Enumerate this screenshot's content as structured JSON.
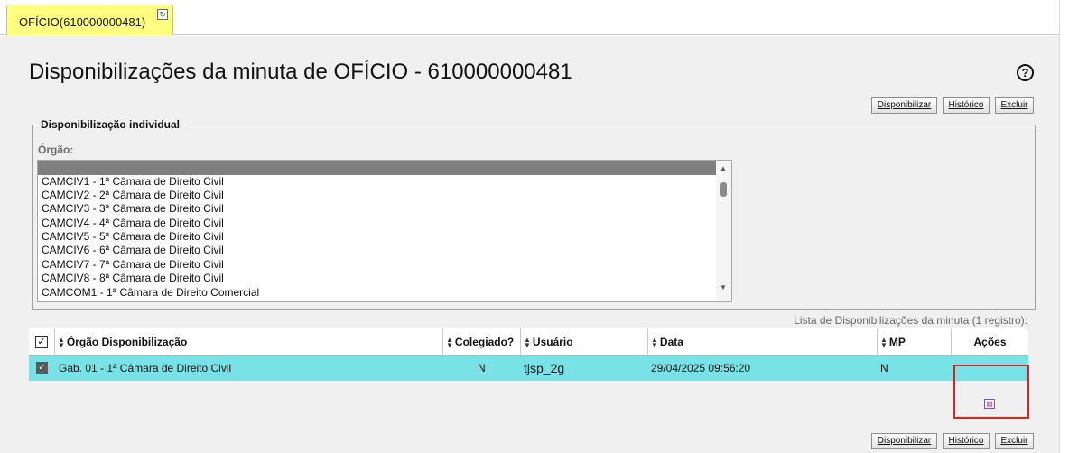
{
  "tab": {
    "label": "OFÍCIO(610000000481)",
    "refresh_icon": "refresh-icon"
  },
  "page": {
    "title": "Disponibilizações da minuta de OFÍCIO - 610000000481",
    "help_icon": "?"
  },
  "toolbar": {
    "disponibilizar": "Disponibilizar",
    "historico": "Histórico",
    "excluir": "Excluir"
  },
  "individual": {
    "legend": "Disponibilização individual",
    "orgao_label": "Órgão:",
    "options": [
      "CAMCIV1 - 1ª Câmara de Direito Civil",
      "CAMCIV2 - 2ª Câmara de Direito Civil",
      "CAMCIV3 - 3ª Câmara de Direito Civil",
      "CAMCIV4 - 4ª Câmara de Direito Civil",
      "CAMCIV5 - 5ª Câmara de Direito Civil",
      "CAMCIV6 - 6ª Câmara de Direito Civil",
      "CAMCIV7 - 7ª Câmara de Direito Civil",
      "CAMCIV8 - 8ª Câmara de Direito Civil",
      "CAMCOM1 - 1ª Câmara de Direito Comercial"
    ]
  },
  "list": {
    "caption": "Lista de Disponibilizações da minuta (1 registro):",
    "headers": {
      "orgao": "Órgão Disponibilização",
      "colegiado": "Colegiado?",
      "usuario": "Usuário",
      "data": "Data",
      "mp": "MP",
      "acoes": "Ações"
    },
    "rows": [
      {
        "orgao": "Gab. 01 - 1ª Câmara de Direito Civil",
        "colegiado": "N",
        "usuario": "tjsp_2g",
        "data": "29/04/2025 09:56:20",
        "mp": "N",
        "checked": true
      }
    ]
  },
  "colors": {
    "tab_bg": "#ffff80",
    "row_bg": "#79e2e6",
    "highlight": "#e02020"
  }
}
